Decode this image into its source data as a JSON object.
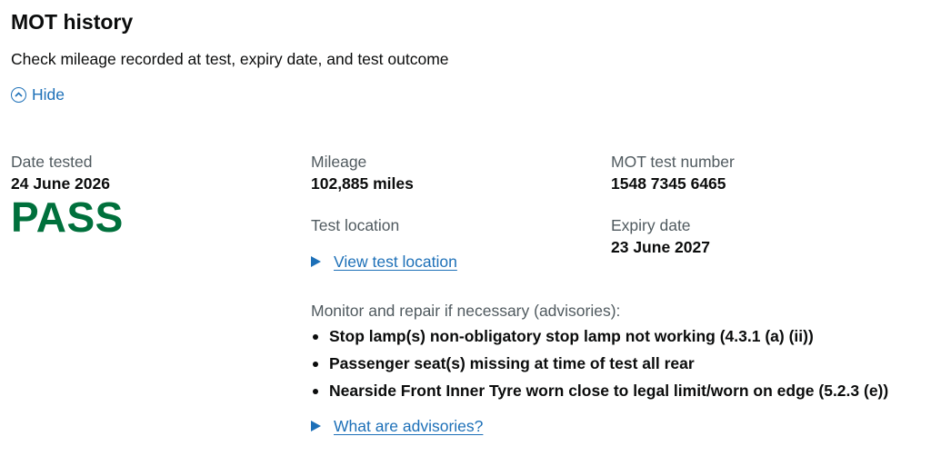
{
  "header": {
    "title": "MOT history",
    "subtitle": "Check mileage recorded at test, expiry date, and test outcome",
    "toggle_label": "Hide",
    "toggle_icon": "chevron-up-circle-icon"
  },
  "test": {
    "date_label": "Date tested",
    "date_value": "24 June 2026",
    "result": "PASS",
    "mileage_label": "Mileage",
    "mileage_value": "102,885 miles",
    "location_label": "Test location",
    "location_link": "View test location",
    "test_number_label": "MOT test number",
    "test_number_value": "1548 7345 6465",
    "expiry_label": "Expiry date",
    "expiry_value": "23 June 2027"
  },
  "advisories": {
    "heading": "Monitor and repair if necessary (advisories):",
    "items": [
      "Stop lamp(s) non-obligatory stop lamp not working (4.3.1 (a) (ii))",
      "Passenger seat(s) missing at time of test all rear",
      "Nearside Front Inner Tyre worn close to legal limit/worn on edge (5.2.3 (e))"
    ],
    "help_link": "What are advisories?"
  },
  "colors": {
    "link": "#1d70b8",
    "pass": "#00703c",
    "text": "#0b0c0c",
    "secondary_text": "#505a5f"
  }
}
